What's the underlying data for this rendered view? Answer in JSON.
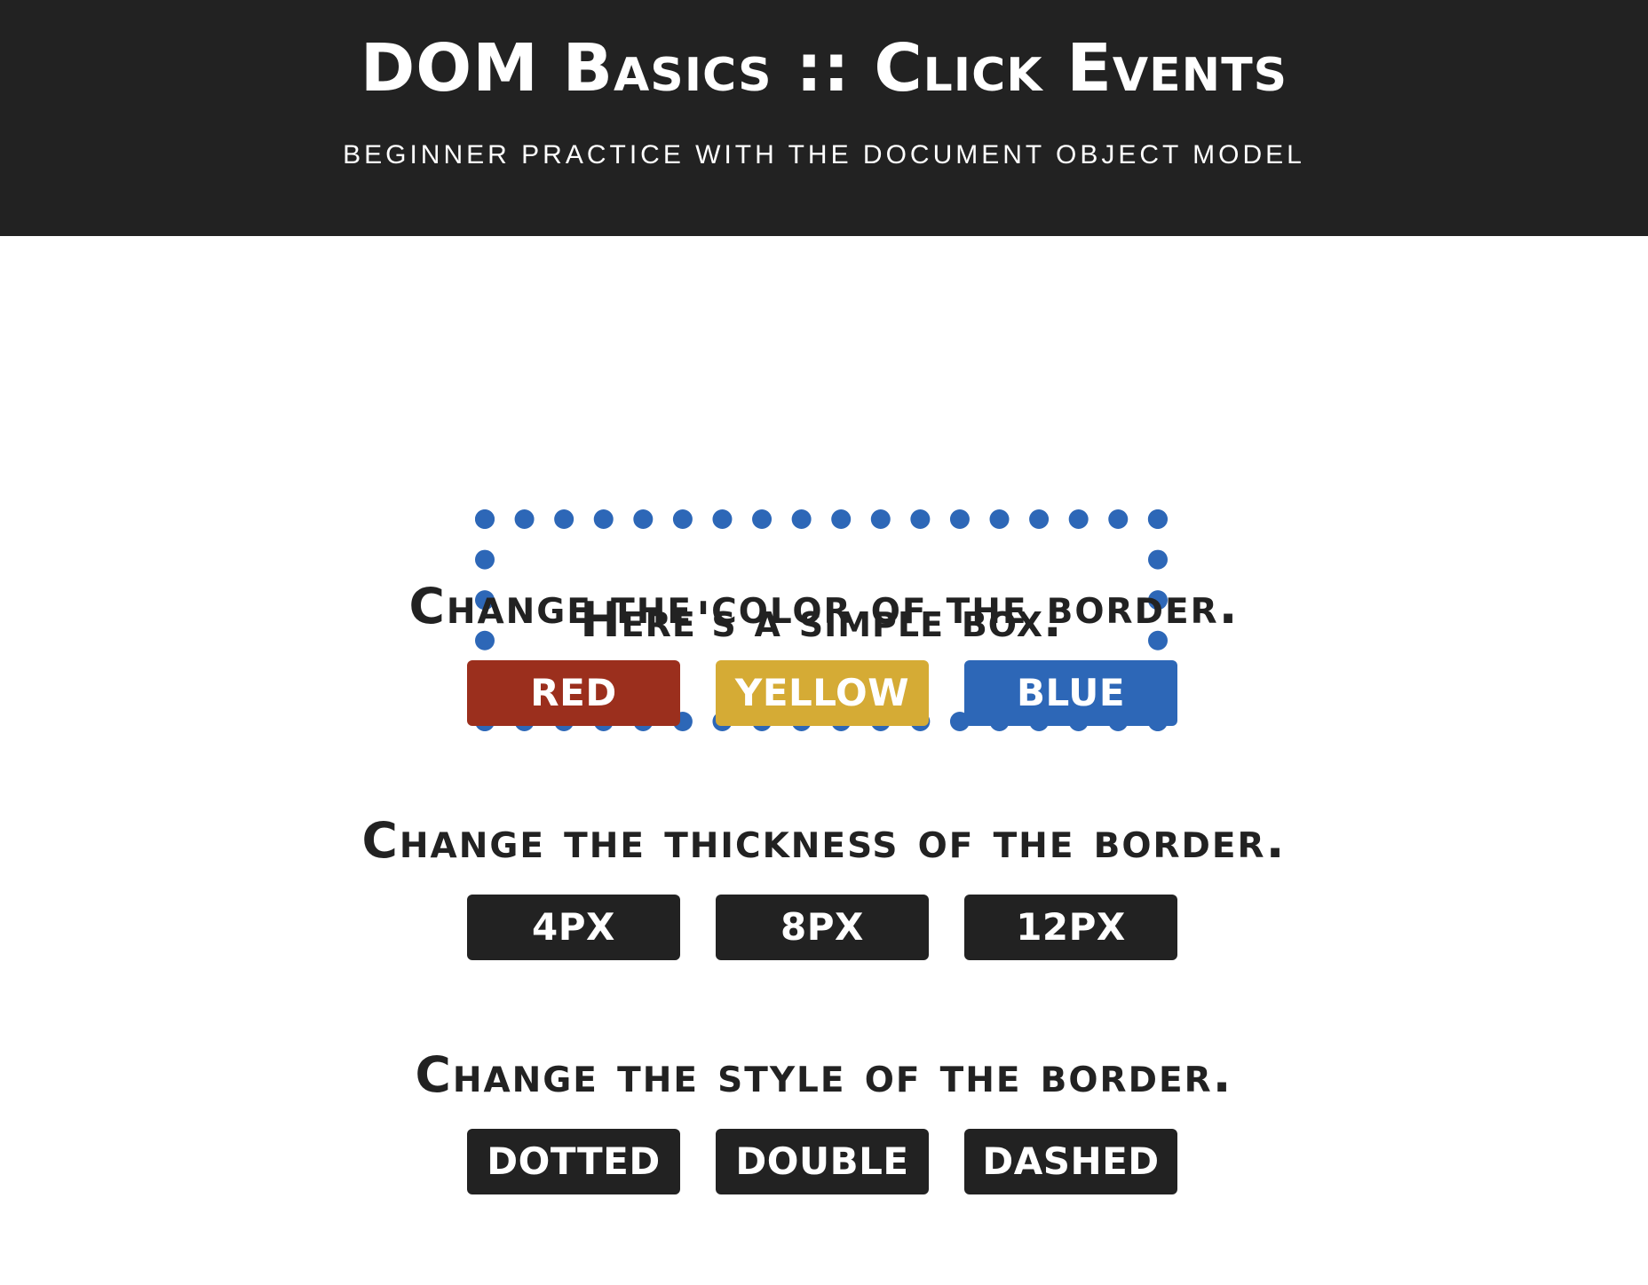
{
  "header": {
    "title": "DOM Basics :: Click Events",
    "subtitle": "BEGINNER PRACTICE WITH THE DOCUMENT OBJECT MODEL"
  },
  "demo_box": {
    "text": "Here's a simple box.",
    "border_color": "#2d67b7",
    "border_style": "dotted"
  },
  "sections": [
    {
      "heading": "Change the color of the border.",
      "buttons": [
        {
          "label": "RED",
          "color": "#9b2f1d"
        },
        {
          "label": "YELLOW",
          "color": "#d5ab35"
        },
        {
          "label": "BLUE",
          "color": "#2d67b7"
        }
      ]
    },
    {
      "heading": "Change the thickness of the border.",
      "buttons": [
        {
          "label": "4PX",
          "color": "#222222"
        },
        {
          "label": "8PX",
          "color": "#222222"
        },
        {
          "label": "12PX",
          "color": "#222222"
        }
      ]
    },
    {
      "heading": "Change the style of the border.",
      "buttons": [
        {
          "label": "DOTTED",
          "color": "#222222"
        },
        {
          "label": "DOUBLE",
          "color": "#222222"
        },
        {
          "label": "DASHED",
          "color": "#222222"
        }
      ]
    }
  ],
  "colors": {
    "header_background": "#222222",
    "page_background": "#ffffff",
    "text_dark": "#222222",
    "text_light": "#ffffff"
  }
}
